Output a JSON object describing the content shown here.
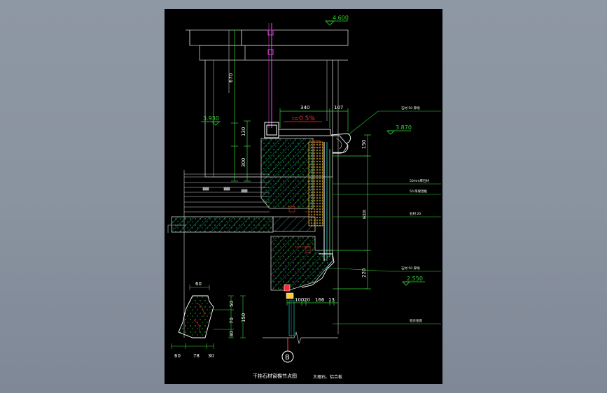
{
  "drawing": {
    "title": "干挂石材窗檐节点图",
    "subtitle": "大理石、铝合板",
    "section_marker": "B",
    "slope_label": "i=0.5%",
    "elevations": [
      {
        "id": "top",
        "value": "4.600"
      },
      {
        "id": "left",
        "value": "3.930"
      },
      {
        "id": "right-upper",
        "value": "3.870"
      },
      {
        "id": "right-lower",
        "value": "2.550"
      }
    ],
    "dimensions": {
      "left_vertical": [
        "670",
        "130",
        "300"
      ],
      "top_horizontal": [
        "340",
        "107"
      ],
      "right_vertical": [
        "150",
        "220"
      ],
      "bottom_horizontal": [
        "100",
        "20",
        "166",
        "13"
      ],
      "detail_top": "60",
      "detail_vertical": [
        "50",
        "70",
        "30"
      ],
      "detail_total": "150",
      "detail_bottom": [
        "60",
        "78",
        "30"
      ]
    },
    "callouts": [
      "石材 50 厚线",
      "50mm厚石材",
      "50 厚保温板",
      "石材 20",
      "石材 50 厚线",
      "铝合金窗"
    ],
    "colors": {
      "background": "#000000",
      "frame": "#8e97a4",
      "elevation": "#36d536",
      "slope_text": "#ff2a2a",
      "dim_text": "#ffffff"
    }
  }
}
